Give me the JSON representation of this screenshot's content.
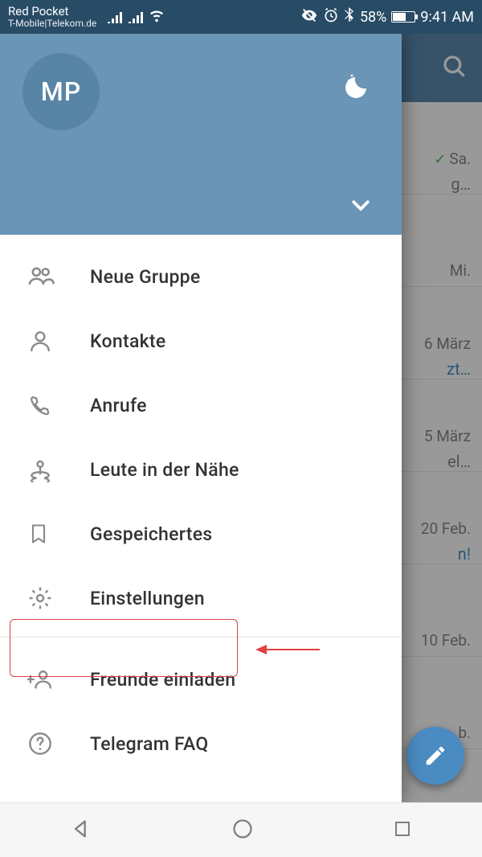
{
  "statusbar": {
    "carrier1": "Red Pocket",
    "carrier2": "T-Mobile|Telekom.de",
    "battery_pct": "58%",
    "time": "9:41 AM"
  },
  "drawer": {
    "avatar_initials": "MP",
    "items": [
      {
        "icon": "group",
        "label": "Neue Gruppe"
      },
      {
        "icon": "contact",
        "label": "Kontakte"
      },
      {
        "icon": "call",
        "label": "Anrufe"
      },
      {
        "icon": "nearby",
        "label": "Leute in der Nähe"
      },
      {
        "icon": "bookmark",
        "label": "Gespeichertes"
      },
      {
        "icon": "settings",
        "label": "Einstellungen"
      }
    ],
    "items2": [
      {
        "icon": "invite",
        "label": "Freunde einladen"
      },
      {
        "icon": "help",
        "label": "Telegram FAQ"
      }
    ]
  },
  "chats": [
    {
      "date": "Sa.",
      "snippet": "g…",
      "checked": true,
      "blue": false
    },
    {
      "date": "Mi.",
      "snippet": "",
      "checked": false,
      "blue": false
    },
    {
      "date": "6 März",
      "snippet": "zt…",
      "checked": false,
      "blue": true
    },
    {
      "date": "5 März",
      "snippet": "el…",
      "checked": false,
      "blue": false
    },
    {
      "date": "20 Feb.",
      "snippet": "n!",
      "checked": false,
      "blue": true
    },
    {
      "date": "10 Feb.",
      "snippet": "",
      "checked": false,
      "blue": false
    },
    {
      "date": "b.",
      "snippet": "",
      "checked": false,
      "blue": false
    }
  ]
}
